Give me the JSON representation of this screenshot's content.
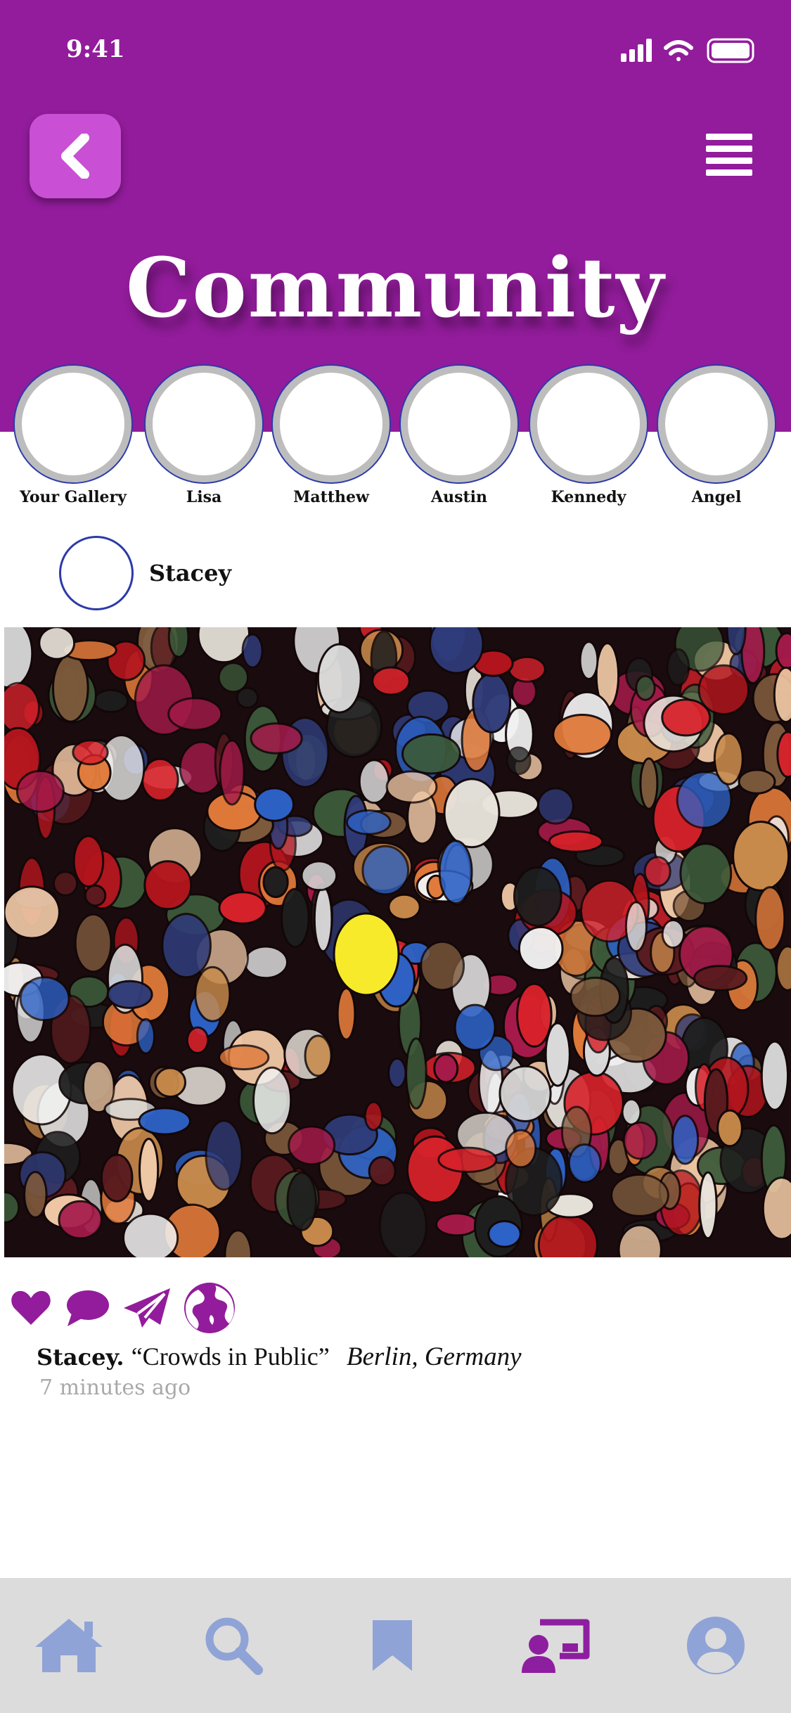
{
  "status_bar": {
    "time": "9:41"
  },
  "header": {
    "title": "Community"
  },
  "colors": {
    "brand": "#921c9b",
    "accent": "#c94fd4",
    "tab_inactive": "#8fa3d6",
    "tab_active": "#8e1ea0",
    "ring_border": "#2c3aa8"
  },
  "stories": [
    {
      "label": "Your Gallery"
    },
    {
      "label": "Lisa"
    },
    {
      "label": "Matthew"
    },
    {
      "label": "Austin"
    },
    {
      "label": "Kennedy"
    },
    {
      "label": "Angel"
    }
  ],
  "post": {
    "username": "Stacey",
    "image_icon": "crowd-photo",
    "actions": [
      "heart-icon",
      "comment-icon",
      "send-icon",
      "globe-icon"
    ],
    "caption_user": "Stacey.",
    "caption_title": "“Crowds in Public”",
    "caption_location": "Berlin, Germany",
    "time_ago": "7 minutes ago"
  },
  "tabbar": {
    "items": [
      "home-icon",
      "search-icon",
      "bookmark-icon",
      "gallery-icon",
      "profile-icon"
    ],
    "active": "gallery-icon"
  }
}
